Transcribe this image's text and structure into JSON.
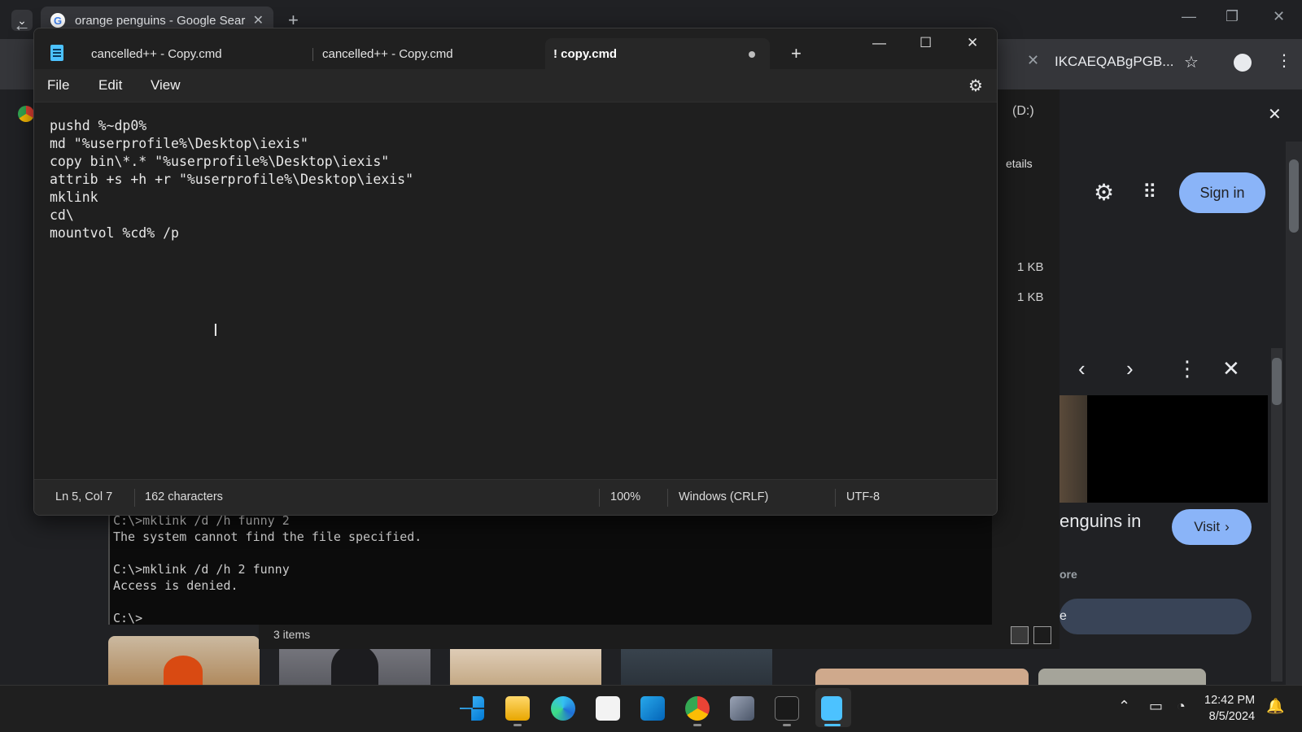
{
  "chrome": {
    "tab_title": "orange penguins - Google Sear",
    "omnibox_tail": "IKCAEQABgPGB...",
    "sign_in": "Sign in",
    "preview_title": "enguins in",
    "visit_label": "Visit",
    "more_label": "ore",
    "search_bar_text": "e"
  },
  "explorer": {
    "drive_label": "(D:)",
    "details_label": "etails",
    "file_sizes": [
      "1 KB",
      "1 KB"
    ],
    "status_items": "3 items"
  },
  "terminal": {
    "lines": "C:\\>mklink /d /h funny 2\nThe system cannot find the file specified.\n\nC:\\>mklink /d /h 2 funny\nAccess is denied.\n\nC:\\>"
  },
  "notepad": {
    "tabs": [
      {
        "label": "cancelled++ - Copy.cmd"
      },
      {
        "label": "cancelled++ - Copy.cmd"
      },
      {
        "label": "! copy.cmd"
      }
    ],
    "menu": {
      "file": "File",
      "edit": "Edit",
      "view": "View"
    },
    "content": "pushd %~dp0%\nmd \"%userprofile%\\Desktop\\iexis\"\ncopy bin\\*.* \"%userprofile%\\Desktop\\iexis\"\nattrib +s +h +r \"%userprofile%\\Desktop\\iexis\"\nmklink\ncd\\\nmountvol %cd% /p",
    "status": {
      "position": "Ln 5, Col 7",
      "characters": "162 characters",
      "zoom": "100%",
      "line_ending": "Windows (CRLF)",
      "encoding": "UTF-8"
    }
  },
  "taskbar": {
    "time": "12:42 PM",
    "date": "8/5/2024"
  },
  "colors": {
    "accent": "#4cc2ff",
    "chrome_blue": "#8ab4f8"
  }
}
